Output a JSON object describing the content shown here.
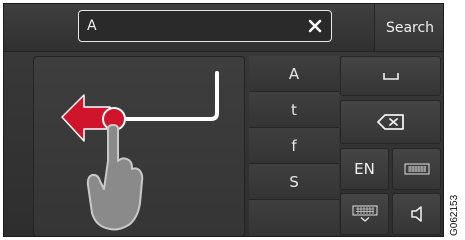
{
  "search": {
    "value": "A",
    "clear_icon": "close-icon",
    "button_label": "Search"
  },
  "handwriting": {
    "gesture": "swipe-left-to-delete",
    "arrow_color": "#d0142c",
    "icons": [
      "arrow-left-icon",
      "finger-icon"
    ]
  },
  "suggestions": [
    "A",
    "t",
    "f",
    "S"
  ],
  "keys": {
    "space_icon": "space-icon",
    "backspace_icon": "backspace-icon",
    "language_label": "EN",
    "keyboard_icon": "keyboard-icon",
    "hide_keyboard_icon": "hide-keyboard-icon",
    "back_icon": "back-icon"
  },
  "image_ref": "G062153"
}
